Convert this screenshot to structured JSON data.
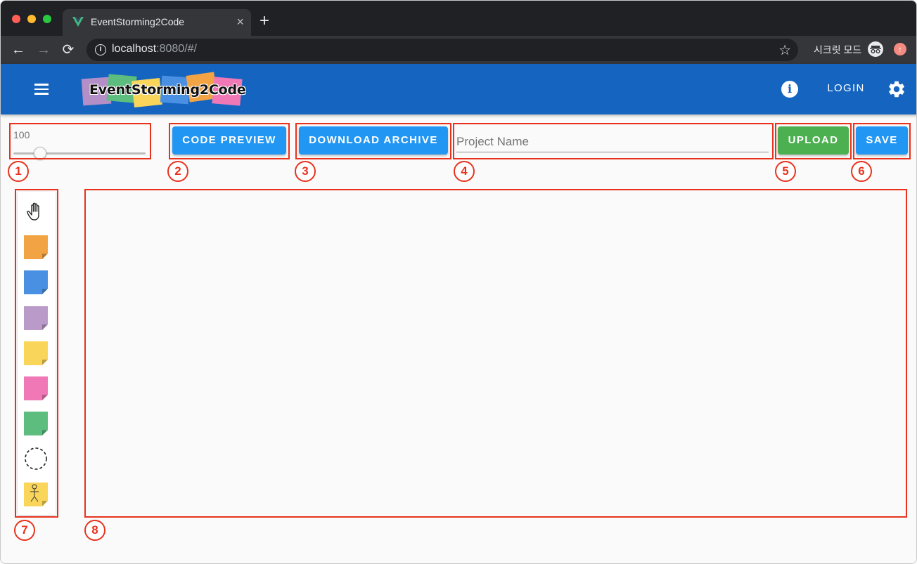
{
  "browser": {
    "tab_title": "EventStorming2Code",
    "new_tab": "+",
    "tab_close": "×",
    "url_host": "localhost",
    "url_rest": ":8080/#/",
    "incognito_label": "시크릿 모드",
    "back_icon": "←",
    "forward_icon": "→",
    "reload_icon": "⟳",
    "star_icon": "☆"
  },
  "appbar": {
    "logo_text": "EventStorming2Code",
    "info_label": "i",
    "login_label": "LOGIN",
    "logo_colors": [
      "#b48ec6",
      "#5dbd7e",
      "#f9d55a",
      "#4a90e2",
      "#f2a343",
      "#f178b6"
    ]
  },
  "controls": {
    "zoom_value": "100",
    "zoom_level": 0.2,
    "code_preview_label": "CODE PREVIEW",
    "download_archive_label": "DOWNLOAD ARCHIVE",
    "project_name_placeholder": "Project Name",
    "upload_label": "UPLOAD",
    "save_label": "SAVE"
  },
  "palette": {
    "items": [
      {
        "name": "hand-tool-icon",
        "type": "hand"
      },
      {
        "name": "sticky-orange-icon",
        "type": "sticky",
        "color": "#f2a343"
      },
      {
        "name": "sticky-blue-icon",
        "type": "sticky",
        "color": "#4a90e2"
      },
      {
        "name": "sticky-purple-icon",
        "type": "sticky",
        "color": "#b99ac8"
      },
      {
        "name": "sticky-yellow-icon",
        "type": "sticky",
        "color": "#f9d55a"
      },
      {
        "name": "sticky-pink-icon",
        "type": "sticky",
        "color": "#f178b6"
      },
      {
        "name": "sticky-green-icon",
        "type": "sticky",
        "color": "#5dbd7e"
      },
      {
        "name": "bounded-context-icon",
        "type": "dashed-circle"
      },
      {
        "name": "actor-sticky-icon",
        "type": "actor",
        "color": "#f9d55a"
      }
    ]
  },
  "annotations": [
    "1",
    "2",
    "3",
    "4",
    "5",
    "6",
    "7",
    "8"
  ],
  "colors": {
    "annotation": "#e8321e",
    "appbar": "#1565c0",
    "primary_button": "#2196f3",
    "upload_button": "#4caf50"
  }
}
